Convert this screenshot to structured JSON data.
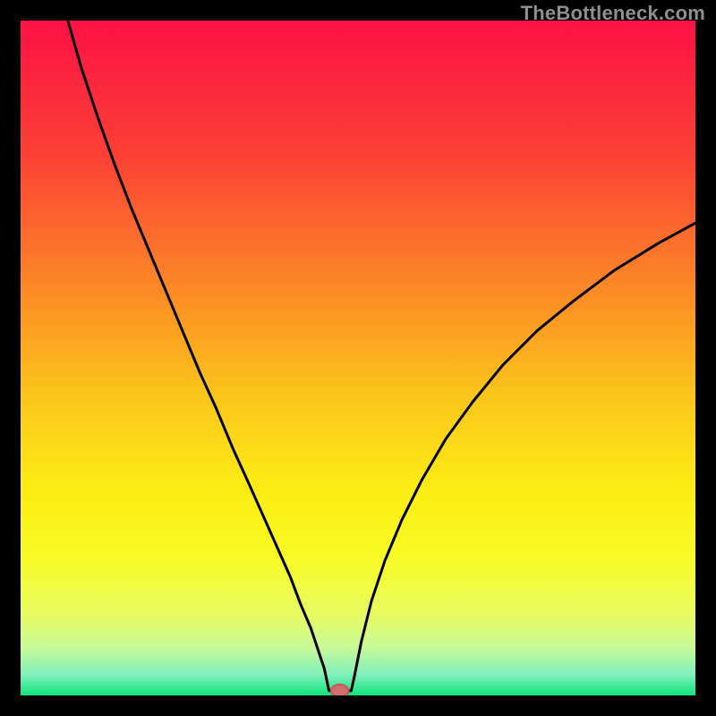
{
  "watermark": "TheBottleneck.com",
  "chart_data": {
    "type": "line",
    "title": "",
    "xlabel": "",
    "ylabel": "",
    "xlim": [
      0,
      100
    ],
    "ylim": [
      0,
      100
    ],
    "grid": false,
    "legend": false,
    "axes_visible": false,
    "background": {
      "type": "vertical-gradient",
      "stops": [
        {
          "offset": 0.0,
          "color": "#fd1146"
        },
        {
          "offset": 0.2,
          "color": "#fc4035"
        },
        {
          "offset": 0.4,
          "color": "#fc8a26"
        },
        {
          "offset": 0.55,
          "color": "#fbc31b"
        },
        {
          "offset": 0.7,
          "color": "#fcee14"
        },
        {
          "offset": 0.8,
          "color": "#f8fb28"
        },
        {
          "offset": 0.88,
          "color": "#e7fb61"
        },
        {
          "offset": 0.93,
          "color": "#c7f99a"
        },
        {
          "offset": 0.97,
          "color": "#7eefbb"
        },
        {
          "offset": 1.0,
          "color": "#0ee479"
        }
      ]
    },
    "series": [
      {
        "name": "bottleneck-curve",
        "color": "#000000",
        "width": 3,
        "x": [
          7.0,
          9.0,
          11.5,
          14.0,
          16.5,
          19.0,
          21.5,
          24.0,
          26.5,
          29.0,
          31.5,
          34.0,
          36.0,
          38.0,
          40.0,
          41.5,
          43.0,
          44.0,
          45.0,
          45.7,
          49.0,
          49.5,
          50.5,
          52.0,
          54.0,
          56.5,
          59.5,
          63.0,
          67.0,
          71.5,
          76.5,
          82.0,
          88.0,
          94.5,
          100.0
        ],
        "y": [
          100.0,
          93.0,
          85.5,
          78.5,
          72.0,
          66.0,
          60.0,
          54.0,
          48.0,
          42.5,
          36.5,
          31.0,
          26.5,
          22.0,
          17.5,
          13.5,
          10.0,
          7.0,
          4.0,
          0.7,
          0.7,
          3.0,
          8.0,
          14.0,
          20.0,
          26.0,
          32.0,
          38.0,
          43.5,
          49.0,
          54.0,
          58.5,
          63.0,
          67.0,
          70.0
        ]
      }
    ],
    "marker": {
      "name": "optimum-point",
      "x": 47.3,
      "y": 0.7,
      "rx": 1.3,
      "ry": 0.9,
      "fill": "#d07070",
      "stroke": "#c85a5a"
    }
  },
  "colors": {
    "page_bg": "#000000",
    "curve": "#000000",
    "watermark": "#8f8f8f",
    "marker_fill": "#d07070",
    "marker_stroke": "#c85a5a"
  }
}
